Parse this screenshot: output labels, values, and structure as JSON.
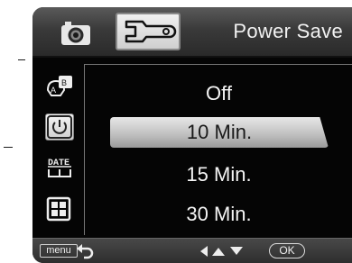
{
  "header": {
    "title": "Power Save",
    "tabs": [
      {
        "name": "camera",
        "icon": "camera-icon",
        "active": false
      },
      {
        "name": "settings",
        "icon": "wrench-icon",
        "active": true
      }
    ]
  },
  "sidebar": {
    "items": [
      {
        "icon": "language-icon"
      },
      {
        "icon": "power-icon",
        "active": true
      },
      {
        "icon": "date-icon",
        "label": "DATE"
      },
      {
        "icon": "grid-icon"
      }
    ]
  },
  "menu": {
    "options": [
      "Off",
      "10 Min.",
      "15 Min.",
      "30 Min."
    ],
    "selected": "10 Min."
  },
  "footer": {
    "menu_label": "menu",
    "ok_label": "OK",
    "hints": [
      "back-arrow-icon",
      "left-arrow-icon",
      "up-arrow-icon",
      "down-arrow-icon"
    ]
  }
}
